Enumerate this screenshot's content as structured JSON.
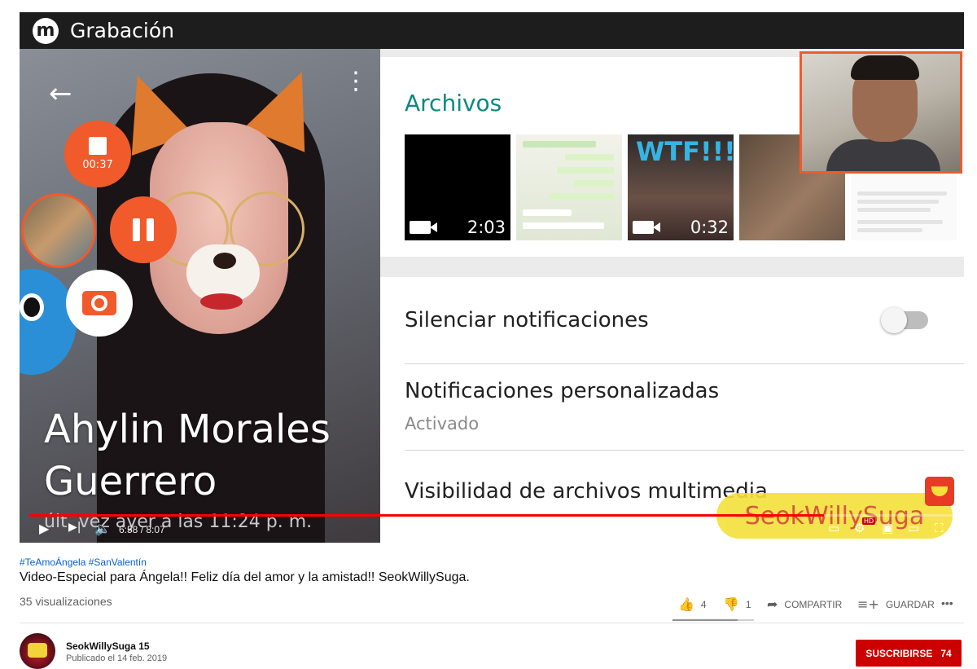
{
  "player": {
    "recording_bar": {
      "logo": "m",
      "title": "Grabación"
    },
    "chat_ui": {
      "timer": "00:37",
      "contact_name_line1": "Ahylin Morales",
      "contact_name_line2": "Guerrero",
      "last_seen": "últ. vez ayer a las 11:24 p. m.",
      "files_title": "Archivos",
      "files": [
        {
          "type": "video",
          "duration": "2:03"
        },
        {
          "type": "image"
        },
        {
          "type": "video",
          "duration": "0:32",
          "overlay_text": "WTF!!!"
        },
        {
          "type": "image"
        },
        {
          "type": "image"
        }
      ],
      "settings": [
        {
          "label": "Silenciar notificaciones",
          "toggle_on": false
        },
        {
          "label": "Notificaciones personalizadas",
          "sublabel": "Activado"
        },
        {
          "label": "Visibilidad de archivos multimedia"
        }
      ],
      "accent_color": "#f15a2b",
      "title_color": "#0b8a7c"
    },
    "watermark": "SeokWillySuga",
    "controls": {
      "current_time": "6:58",
      "total_time": "8:07",
      "time_display": "6:58 / 8:07",
      "progress_fraction": 0.859,
      "hd_badge": "HD",
      "progress_color": "#ff0000"
    }
  },
  "video": {
    "hashtags": "#TeAmoÁngela #SanValentín",
    "title": "Video-Especial para Ángela!! Feliz día del amor y la amistad!! SeokWillySuga.",
    "views": "35 visualizaciones",
    "likes": "4",
    "dislikes": "1",
    "like_ratio": 0.8,
    "share_label": "COMPARTIR",
    "save_label": "GUARDAR",
    "more_label": "•••"
  },
  "channel": {
    "name": "SeokWillySuga 15",
    "published": "Publicado el 14 feb. 2019",
    "subscribe_label": "SUSCRIBIRSE",
    "subscriber_count": "74"
  }
}
